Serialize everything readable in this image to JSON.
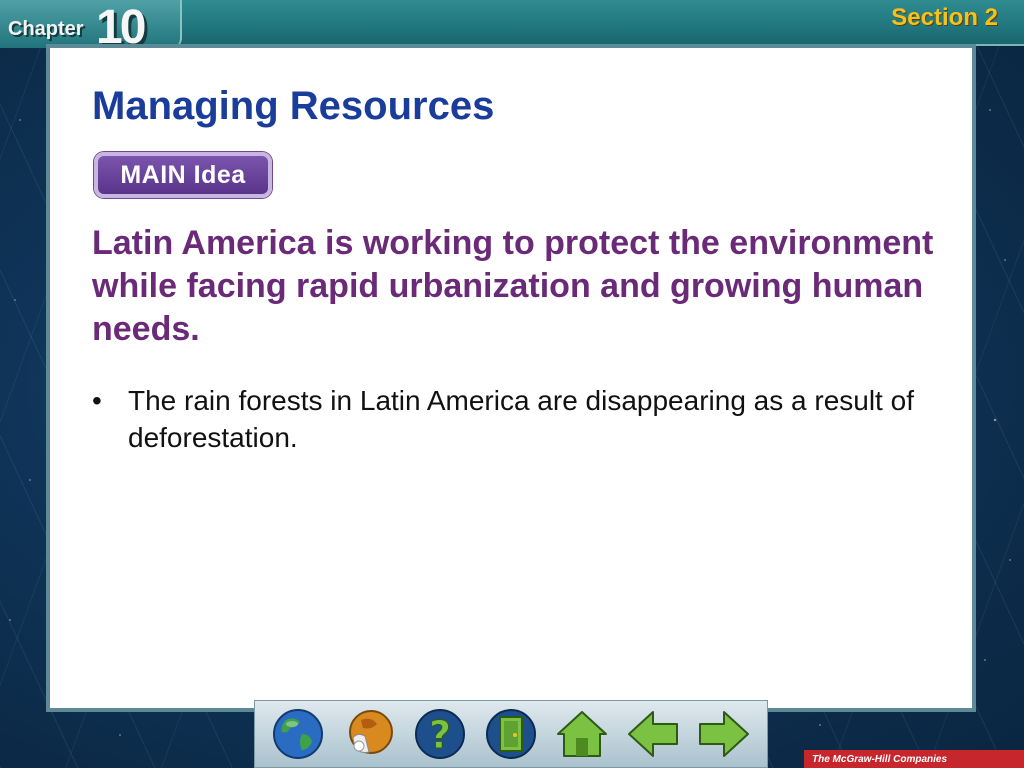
{
  "header": {
    "chapter_word": "Chapter",
    "chapter_number": "10",
    "section": "Section 2"
  },
  "slide": {
    "title": "Managing Resources",
    "main_idea_badge": "MAIN Idea",
    "main_idea_statement": "Latin America is working to protect the environment while facing rapid urbanization and growing human needs.",
    "bullets": [
      {
        "marker": "•",
        "text": "The rain forests in Latin America are disappearing as a result of deforestation."
      }
    ]
  },
  "nav_buttons": [
    {
      "name": "globe-icon"
    },
    {
      "name": "resources-icon"
    },
    {
      "name": "help-icon",
      "glyph": "?"
    },
    {
      "name": "exit-door-icon"
    },
    {
      "name": "home-icon"
    },
    {
      "name": "previous-arrow-icon"
    },
    {
      "name": "next-arrow-icon"
    }
  ],
  "footer": {
    "publisher": "The McGraw-Hill Companies"
  },
  "colors": {
    "title_blue": "#1a3c9a",
    "statement_purple": "#6a2a78",
    "section_gold": "#f3c21c",
    "header_teal": "#19676f",
    "nav_green": "#7cc242"
  }
}
